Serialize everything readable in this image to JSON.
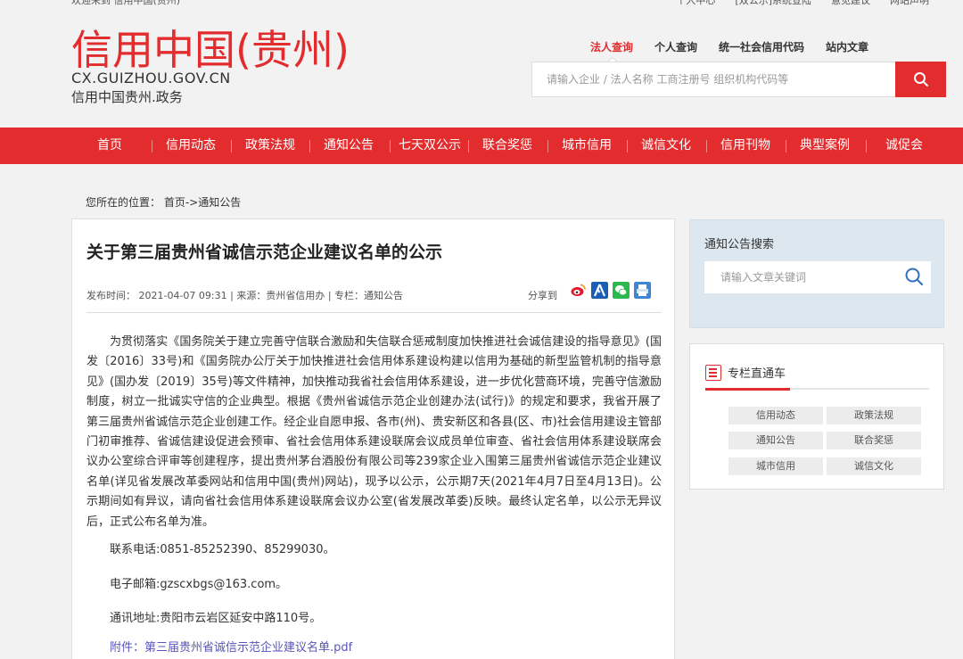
{
  "topbar": {
    "welcome": "欢迎来到 信用中国(贵州)",
    "links": [
      "个人中心",
      "[双公示]系统登陆",
      "意见建议",
      "网站声明"
    ]
  },
  "header": {
    "logo_title": "信用中国(贵州)",
    "logo_domain": "CX.GUIZHOU.GOV.CN",
    "logo_sub": "信用中国贵州.政务",
    "search_tabs": [
      "法人查询",
      "个人查询",
      "统一社会信用代码",
      "站内文章"
    ],
    "active_tab": "法人查询",
    "search_placeholder": "请输入企业 / 法人名称 工商注册号 组织机构代码等",
    "search_icon": "search-icon"
  },
  "nav": {
    "items": [
      "首页",
      "信用动态",
      "政策法规",
      "通知公告",
      "七天双公示",
      "联合奖惩",
      "城市信用",
      "诚信文化",
      "信用刊物",
      "典型案例",
      "诚促会"
    ]
  },
  "breadcrumb": {
    "label": "您所在的位置：",
    "path": "首页->通知公告"
  },
  "article": {
    "title": "关于第三届贵州省诚信示范企业建议名单的公示",
    "meta": "发布时间： 2021-04-07 09:31    |   来源：贵州省信用办    |   专栏：通知公告",
    "share_label": "分享到",
    "share_icons": [
      "weibo-icon",
      "renren-icon",
      "wechat-icon",
      "print-icon"
    ],
    "body": "为贯彻落实《国务院关于建立完善守信联合激励和失信联合惩戒制度加快推进社会诚信建设的指导意见》(国发〔2016〕33号)和《国务院办公厅关于加快推进社会信用体系建设构建以信用为基础的新型监管机制的指导意见》(国办发〔2019〕35号)等文件精神，加快推动我省社会信用体系建设，进一步优化营商环境，完善守信激励制度，树立一批诚实守信的企业典型。根据《贵州省诚信示范企业创建办法(试行)》的规定和要求，我省开展了第三届贵州省诚信示范企业创建工作。经企业自愿申报、各市(州)、贵安新区和各县(区、市)社会信用建设主管部门初审推荐、省诚信建设促进会预审、省社会信用体系建设联席会议成员单位审查、省社会信用体系建设联席会议办公室综合评审等创建程序，提出贵州茅台酒股份有限公司等239家企业入围第三届贵州省诚信示范企业建议名单(详见省发展改革委网站和信用中国(贵州)网站)，现予以公示，公示期7天(2021年4月7日至4月13日)。公示期间如有异议，请向省社会信用体系建设联席会议办公室(省发展改革委)反映。最终认定名单，以公示无异议后，正式公布名单为准。",
    "phone": "联系电话:0851-85252390、85299030。",
    "email": "电子邮箱:gzscxbgs@163.com。",
    "address": "通讯地址:贵阳市云岩区延安中路110号。",
    "attachment": "附件：第三届贵州省诚信示范企业建议名单.pdf"
  },
  "sidebar": {
    "search_label": "通知公告搜索",
    "search_placeholder": "请输入文章关键词",
    "links_header": "专栏直通车",
    "links": [
      "信用动态",
      "政策法规",
      "通知公告",
      "联合奖惩",
      "城市信用",
      "诚信文化"
    ]
  },
  "colors": {
    "brand_red": "#e22c2e",
    "link_purple": "#5a55b8"
  }
}
